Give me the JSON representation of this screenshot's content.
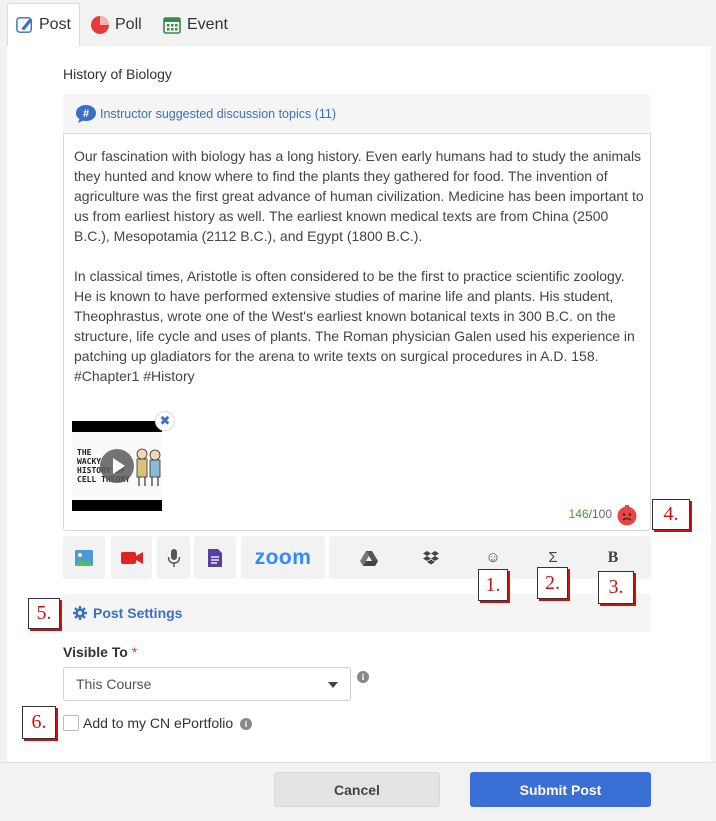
{
  "tabs": [
    {
      "label": "Post",
      "icon": "post-pen-icon",
      "active": true
    },
    {
      "label": "Poll",
      "icon": "pie-chart-icon",
      "active": false
    },
    {
      "label": "Event",
      "icon": "calendar-icon",
      "active": false
    }
  ],
  "post": {
    "title": "History of Biology",
    "topics_link": "Instructor suggested discussion topics (11)",
    "body_paragraphs": [
      "Our fascination with biology has a long history. Even early humans had to study the animals they hunted and know where to find the plants they gathered for food. The invention of agriculture was the first great advance of human civilization. Medicine has been important to us from earliest history as well. The earliest known medical texts are from China (2500 B.C.), Mesopotamia (2112 B.C.), and Egypt (1800 B.C.).",
      "In classical times, Aristotle is often considered to be the first to practice scientific zoology. He is known to have performed extensive studies of marine life and plants. His student, Theophrastus, wrote one of the West's earliest known botanical texts in 300 B.C. on the structure, life cycle and uses of plants. The Roman physician Galen used his experience in patching up gladiators for the arena to write texts on surgical procedures in A.D. 158. #Chapter1 #History"
    ],
    "attachment": {
      "type": "video",
      "thumbnail_text": "THE WACKY HISTORY OF CELL THEORY",
      "thumbnail_lines": [
        "THE",
        "WACKY",
        "HISTORY OF",
        "CELL THEORY"
      ],
      "remove_symbol": "✖"
    },
    "word_count": {
      "current": "146",
      "separator": "/",
      "max": "100"
    }
  },
  "toolbar": {
    "zoom_label": "zoom",
    "emoji_symbol": "☺",
    "sigma_symbol": "Σ",
    "bold_symbol": "B"
  },
  "settings": {
    "label": "Post Settings",
    "visible_to_label": "Visible To",
    "required_mark": "*",
    "visible_to_value": "This Course",
    "eportfolio_label": "Add to my CN ePortfolio",
    "eportfolio_checked": false
  },
  "footer": {
    "cancel_label": "Cancel",
    "submit_label": "Submit Post"
  },
  "markers": [
    "1.",
    "2.",
    "3.",
    "4.",
    "5.",
    "6."
  ],
  "colors": {
    "accent": "#3a6fd6",
    "link": "#3a6fc8",
    "counter_current": "#4a9a2a",
    "marker": "#cc1111"
  }
}
